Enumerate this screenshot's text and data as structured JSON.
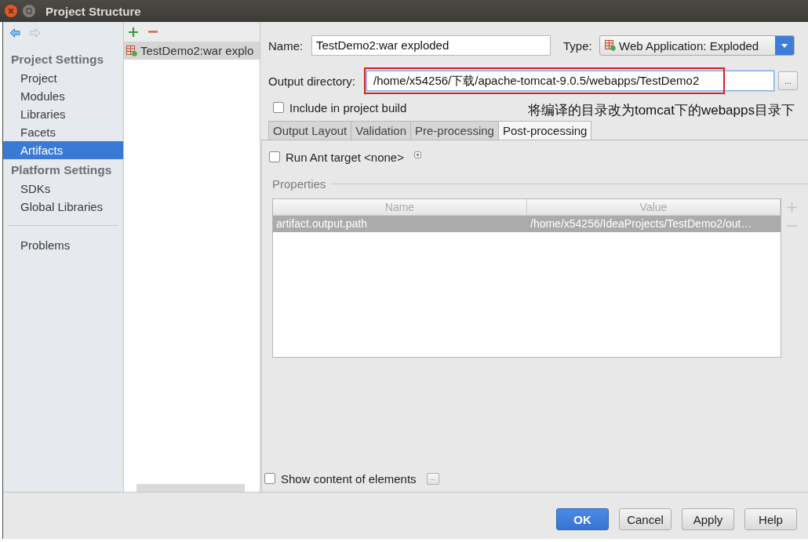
{
  "window": {
    "title": "Project Structure"
  },
  "navigation": [
    {
      "kind": "back",
      "disabled": false
    },
    {
      "kind": "forward",
      "disabled": true
    }
  ],
  "sidebar": {
    "sections": [
      {
        "heading": "Project Settings",
        "items": [
          {
            "label": "Project",
            "selected": false
          },
          {
            "label": "Modules",
            "selected": false
          },
          {
            "label": "Libraries",
            "selected": false
          },
          {
            "label": "Facets",
            "selected": false
          },
          {
            "label": "Artifacts",
            "selected": true
          }
        ]
      },
      {
        "heading": "Platform Settings",
        "items": [
          {
            "label": "SDKs",
            "selected": false
          },
          {
            "label": "Global Libraries",
            "selected": false
          }
        ]
      }
    ],
    "footer_items": [
      {
        "label": "Problems",
        "selected": false
      }
    ]
  },
  "artifacts": {
    "items": [
      {
        "label": "TestDemo2:war explo",
        "selected": true
      }
    ]
  },
  "form": {
    "name": {
      "label": "Name:",
      "value": "TestDemo2:war exploded"
    },
    "type": {
      "label": "Type:",
      "value": "Web Application: Exploded"
    },
    "output_directory": {
      "label": "Output directory:",
      "value": "/home/x54256/下载/apache-tomcat-9.0.5/webapps/TestDemo2",
      "browse_button": "..."
    },
    "include_in_build": {
      "label": "Include in project build",
      "checked": false
    }
  },
  "annotation": {
    "text": "将编译的目录改为tomcat下的webapps目录下"
  },
  "tabs": [
    {
      "label": "Output Layout",
      "selected": false
    },
    {
      "label": "Validation",
      "selected": false
    },
    {
      "label": "Pre-processing",
      "selected": false
    },
    {
      "label": "Post-processing",
      "selected": true
    }
  ],
  "post_processing": {
    "run_ant_target": {
      "label": "Run Ant target <none>",
      "checked": false
    },
    "properties": {
      "title": "Properties",
      "columns": [
        "Name",
        "Value"
      ],
      "rows": [
        {
          "cells": [
            "artifact.output.path",
            "/home/x54256/IdeaProjects/TestDemo2/out…"
          ],
          "selected": true
        }
      ]
    },
    "show_content": {
      "label": "Show content of elements",
      "checked": false,
      "options_button": "..."
    }
  },
  "buttons": [
    {
      "label": "OK",
      "kind": "primary"
    },
    {
      "label": "Cancel",
      "kind": "secondary"
    },
    {
      "label": "Apply",
      "kind": "secondary"
    },
    {
      "label": "Help",
      "kind": "secondary"
    }
  ]
}
